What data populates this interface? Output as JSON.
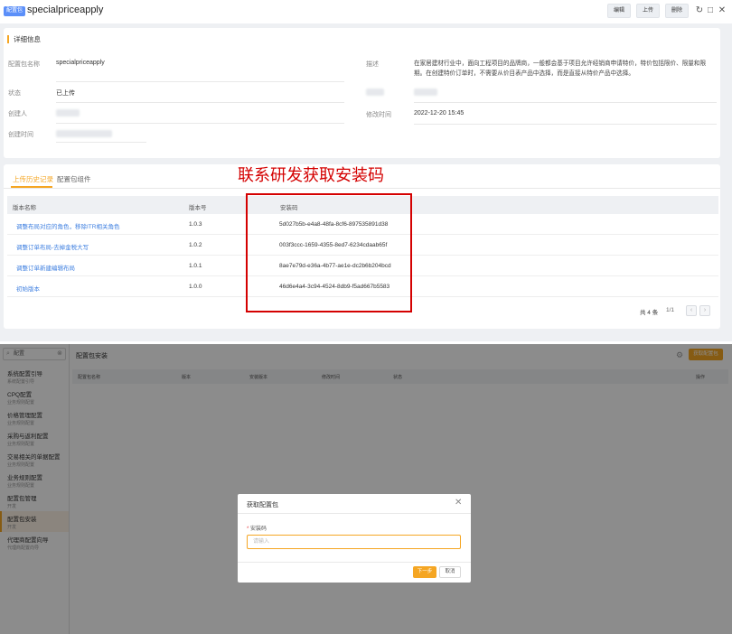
{
  "header": {
    "badge": "配置包",
    "title": "specialpriceapply",
    "buttons": {
      "edit": "编辑",
      "upload": "上传",
      "delete": "删除"
    }
  },
  "detail": {
    "section_title": "详细信息",
    "name_label": "配置包名称",
    "name_value": "specialpriceapply",
    "status_label": "状态",
    "status_value": "已上传",
    "creator_label": "创建人",
    "created_time_label": "创建时间",
    "desc_label": "描述",
    "desc_value": "在家居建材行业中，面向工程项目的品牌商，一般都会基于项目允许经销商申请特价，特价包括限价、限量和限期。在创建特价订单时，不需要从价目表产品中选择，而是直接从特价产品中选择。",
    "modified_time_label": "修改时间",
    "modified_time_value": "2022-12-20 15:45"
  },
  "history": {
    "tabs": [
      "上传历史记录",
      "配置包组件"
    ],
    "columns": [
      "版本名称",
      "版本号",
      "安装码"
    ],
    "rows": [
      {
        "name": "调整布局对应的角色，移除ITR相关角色",
        "version": "1.0.3",
        "code": "5d027b5b-e4a8-48fa-8cf6-897535891d38"
      },
      {
        "name": "调整订单布局-去掉金税大写",
        "version": "1.0.2",
        "code": "003f3ccc-1659-4355-8ed7-6234cdaab65f"
      },
      {
        "name": "调整订单新建编辑布局",
        "version": "1.0.1",
        "code": "8ae7e79d-e36a-4b77-ae1e-dc2b6b204bcd"
      },
      {
        "name": "初始版本",
        "version": "1.0.0",
        "code": "46d6e4a4-3c94-4524-8db9-f5ad667b5583"
      }
    ],
    "pagination": {
      "total": "共 4 条",
      "page": "1/1"
    }
  },
  "annotation": {
    "text": "联系研发获取安装码",
    "color": "#d40000"
  },
  "bottom": {
    "search_placeholder": "配置",
    "sidebar": [
      {
        "title": "系统配置引导",
        "sub": "系统配置引导"
      },
      {
        "title": "CPQ配置",
        "sub": "业务规则配置"
      },
      {
        "title": "价格管理配置",
        "sub": "业务规则配置"
      },
      {
        "title": "采购与返利配置",
        "sub": "业务规则配置"
      },
      {
        "title": "交易相关的单据配置",
        "sub": "业务规则配置"
      },
      {
        "title": "业务规则配置",
        "sub": "业务规则配置"
      },
      {
        "title": "配置包管理",
        "sub": "开发"
      },
      {
        "title": "配置包安装",
        "sub": "开发"
      },
      {
        "title": "代理商配置向导",
        "sub": "代理商配置向导"
      }
    ],
    "main_title": "配置包安装",
    "action_button": "获取配置包",
    "columns": [
      "配置包名称",
      "版本",
      "安装版本",
      "修改时间",
      "状态",
      "操作"
    ],
    "modal": {
      "title": "获取配置包",
      "field_label": "安装码",
      "placeholder": "请输入",
      "next": "下一步",
      "cancel": "取消"
    }
  },
  "colors": {
    "accent": "#f5a623",
    "link": "#3e7fe0",
    "badge": "#5b8ff9"
  }
}
